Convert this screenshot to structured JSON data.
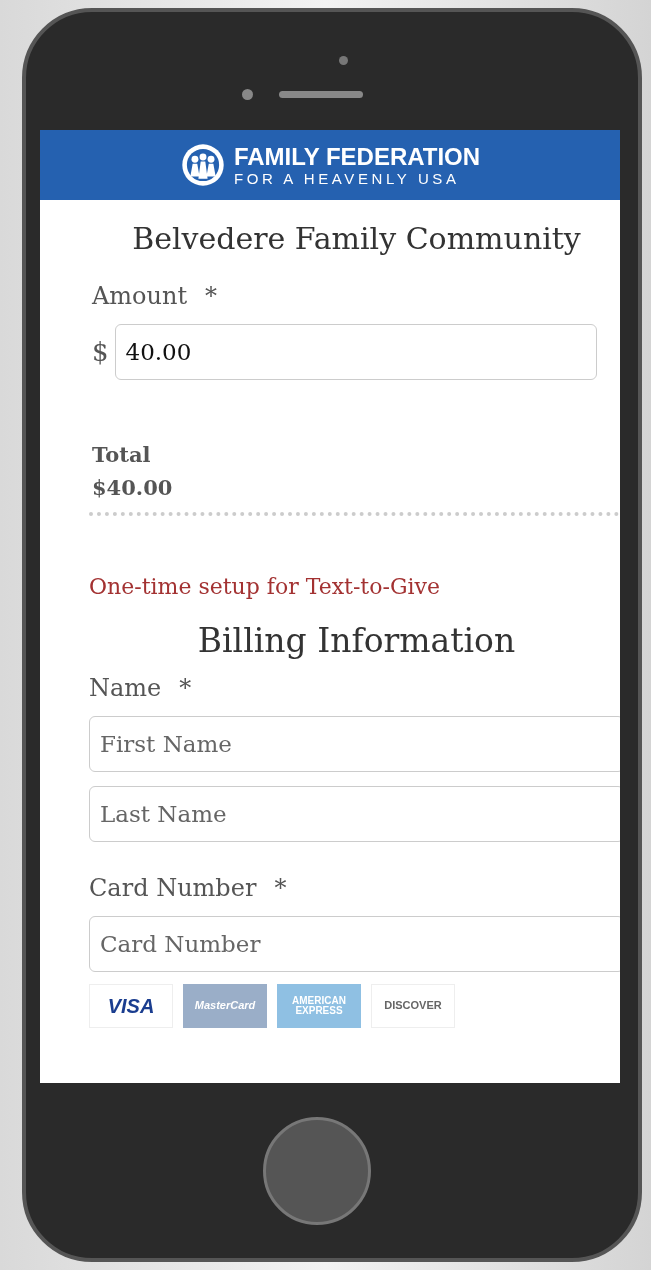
{
  "header": {
    "logo_line_1": "FAMILY FEDERATION",
    "logo_line_2": "FOR A HEAVENLY USA"
  },
  "title": "Belvedere Family Community",
  "amount": {
    "label": "Amount",
    "required_mark": "*",
    "currency": "$",
    "value": "40.00"
  },
  "total": {
    "label": "Total",
    "value": "$40.00"
  },
  "setup_notice": "One-time setup for Text-to-Give",
  "billing": {
    "heading": "Billing Information",
    "name": {
      "label": "Name",
      "required_mark": "*",
      "fields": [
        {
          "placeholder": "First Name"
        },
        {
          "placeholder": "Last Name"
        }
      ]
    },
    "card_number": {
      "label": "Card Number",
      "required_mark": "*",
      "placeholder": "Card Number"
    },
    "card_logos": [
      {
        "kind": "visa",
        "text": "VISA"
      },
      {
        "kind": "mastercard",
        "text": "MasterCard"
      },
      {
        "kind": "amex",
        "text": "AMERICAN EXPRESS"
      },
      {
        "kind": "discover",
        "text": "DISCOVER"
      }
    ]
  }
}
